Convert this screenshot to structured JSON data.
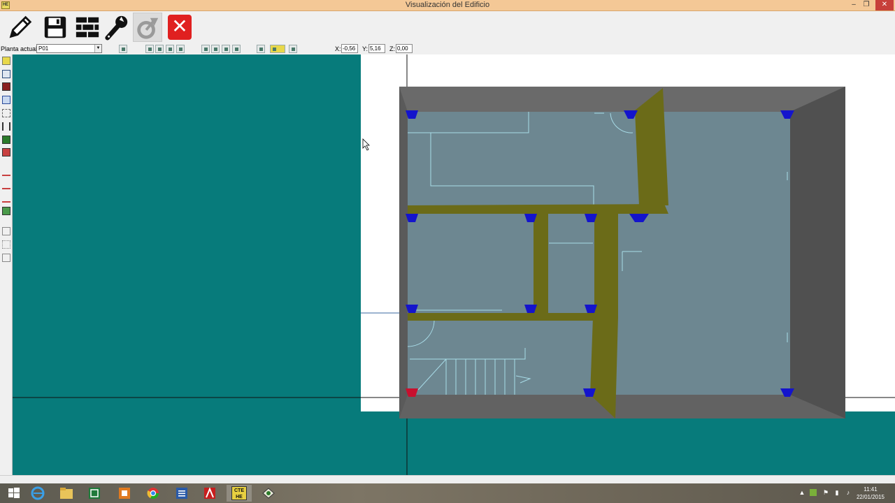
{
  "window": {
    "title": "Visualización del Edificio",
    "app_badge": "HE",
    "minimize": "–",
    "restore": "❐",
    "close": "✕"
  },
  "toolbar": {
    "buttons": [
      {
        "name": "edit-pencil-icon"
      },
      {
        "name": "save-disk-icon"
      },
      {
        "name": "walls-brick-icon"
      },
      {
        "name": "tools-wrench-icon"
      },
      {
        "name": "calculate-disabled-icon"
      },
      {
        "name": "close-view-icon",
        "label": "✕"
      }
    ]
  },
  "toolbar2": {
    "floor_label": "Planta actual",
    "floor_value": "P01",
    "x_label": "X:",
    "x_value": "-0,56",
    "y_label": "Y:",
    "y_value": "5,16",
    "z_label": "Z:",
    "z_value": "0,00"
  },
  "colors": {
    "viewport_bg": "#077b7b",
    "wall_gray": "#5a5a5a",
    "floor_fill": "#6d8791",
    "partition": "#6b6b18",
    "pillar": "#1010c8"
  },
  "taskbar": {
    "time": "11:41",
    "date": "22/01/2015",
    "active_label": "CTE HE"
  }
}
